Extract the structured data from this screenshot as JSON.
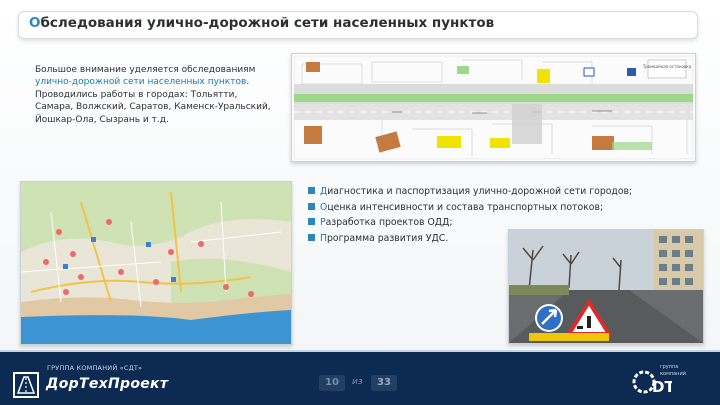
{
  "title": {
    "first": "О",
    "rest": "бследования улично-дорожной сети населенных пунктов"
  },
  "intro": {
    "before": "Большое внимание уделяется обследованиям ",
    "highlight": "улично-дорожной сети населенных пунктов",
    "after": ". Проводились работы в городах: Тольятти, Самара, Волжский, Саратов, Каменск-Уральский, Йошкар-Ола, Сызрань и т.д."
  },
  "plan_labels": {
    "tram_stop": "Трамвайная остановка"
  },
  "tasks": [
    {
      "lead": "Д",
      "rest": "иагностика и паспортизация улично-дорожной сети городов;"
    },
    {
      "lead": "О",
      "rest": "ценка интенсивности и состава транспортных потоков;"
    },
    {
      "lead": "Р",
      "rest": "азработка проектов ОДД;"
    },
    {
      "lead": "П",
      "rest": "рограмма развития УДС."
    }
  ],
  "footer": {
    "group_label": "ГРУППА КОМПАНИЙ «СДТ»",
    "brand": "ДорТехПроект",
    "page_current": "10",
    "page_sep": "из",
    "page_total": "33",
    "sdt_line1": "группа",
    "sdt_line2": "компаний"
  },
  "colors": {
    "accent": "#2e86b8",
    "footer": "#0d2a52",
    "text": "#2b3035"
  }
}
